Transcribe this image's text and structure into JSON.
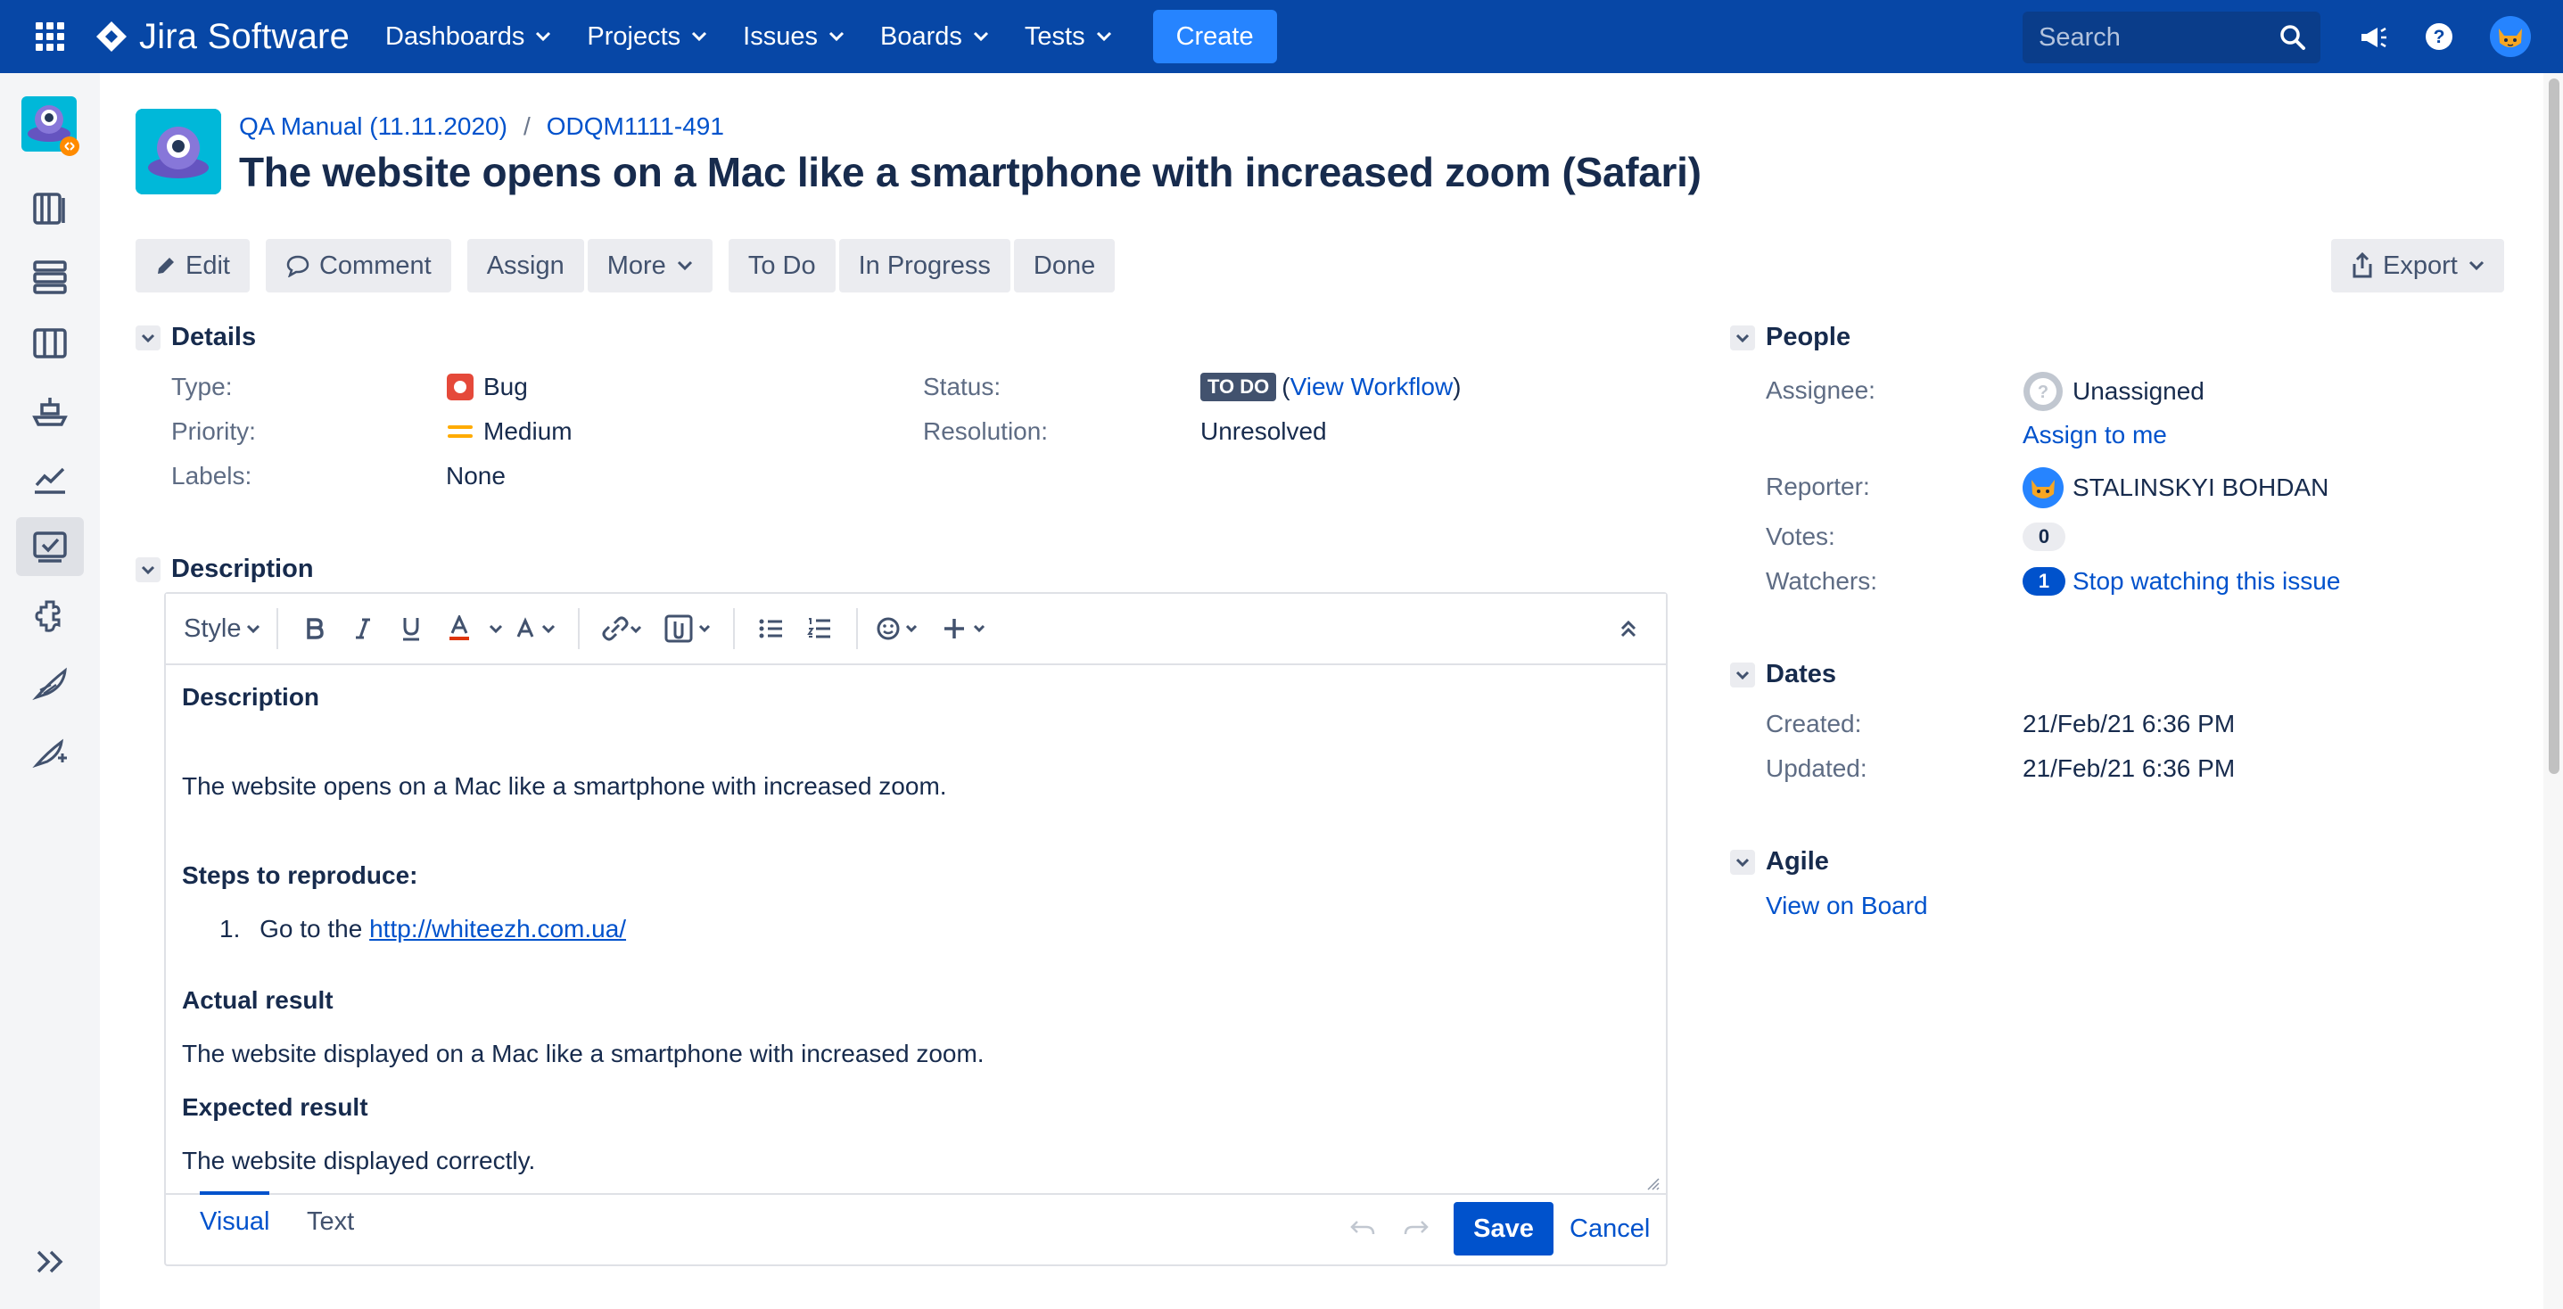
{
  "nav": {
    "brand": "Jira Software",
    "items": [
      "Dashboards",
      "Projects",
      "Issues",
      "Boards",
      "Tests"
    ],
    "create_label": "Create",
    "search_placeholder": "Search"
  },
  "breadcrumb": {
    "project": "QA Manual (11.11.2020)",
    "separator": "/",
    "issue_key": "ODQM1111-491"
  },
  "issue": {
    "title": "The website opens on a Mac like a smartphone with increased zoom (Safari)"
  },
  "toolbar": {
    "edit": "Edit",
    "comment": "Comment",
    "assign": "Assign",
    "more": "More",
    "to_do": "To Do",
    "in_progress": "In Progress",
    "done": "Done",
    "export": "Export"
  },
  "details": {
    "heading": "Details",
    "type_label": "Type:",
    "type_value": "Bug",
    "priority_label": "Priority:",
    "priority_value": "Medium",
    "labels_label": "Labels:",
    "labels_value": "None",
    "status_label": "Status:",
    "status_lozenge": "TO DO",
    "status_open_paren": "(",
    "status_link": "View Workflow",
    "status_close_paren": ")",
    "resolution_label": "Resolution:",
    "resolution_value": "Unresolved"
  },
  "description": {
    "heading": "Description",
    "editor_style": "Style",
    "body": {
      "title": "Description",
      "line1": "The website opens on a Mac like a smartphone with increased zoom.",
      "steps_heading": "Steps to reproduce:",
      "step1_number": "1.",
      "step1_prefix": "Go to the",
      "step1_link": "http://whiteezh.com.ua/",
      "actual_heading": "Actual result",
      "actual_text": "The website displayed on a Mac like a smartphone with increased zoom.",
      "expected_heading": "Expected result",
      "expected_text": "The website displayed correctly."
    },
    "tab_visual": "Visual",
    "tab_text": "Text",
    "save": "Save",
    "cancel": "Cancel"
  },
  "people": {
    "heading": "People",
    "assignee_label": "Assignee:",
    "assignee_value": "Unassigned",
    "assign_to_me": "Assign to me",
    "reporter_label": "Reporter:",
    "reporter_value": "STALINSKYI BOHDAN",
    "votes_label": "Votes:",
    "votes_count": "0",
    "watchers_label": "Watchers:",
    "watchers_count": "1",
    "watchers_link": "Stop watching this issue"
  },
  "dates": {
    "heading": "Dates",
    "created_label": "Created:",
    "created_value": "21/Feb/21 6:36 PM",
    "updated_label": "Updated:",
    "updated_value": "21/Feb/21 6:36 PM"
  },
  "agile": {
    "heading": "Agile",
    "link": "View on Board"
  },
  "colors": {
    "nav_bg": "#0747a6",
    "primary": "#0052cc",
    "create": "#2684ff",
    "bug": "#e5493a",
    "medium": "#ffab00"
  }
}
